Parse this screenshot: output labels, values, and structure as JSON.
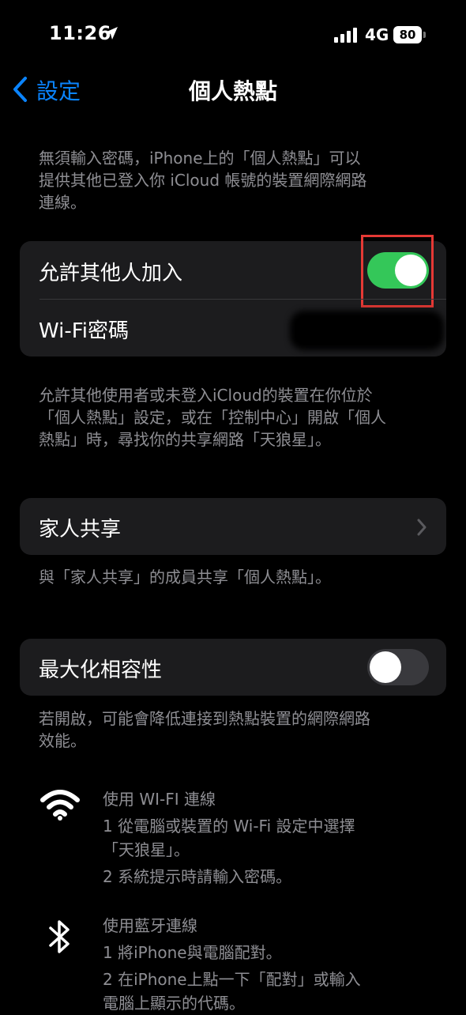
{
  "status_bar": {
    "time": "11:26",
    "network": "4G",
    "battery": "80"
  },
  "nav": {
    "back_label": "設定",
    "title": "個人熱點"
  },
  "intro_text": "無須輸入密碼，iPhone上的「個人熱點」可以提供其他已登入你iCloud帳號的裝置網際網路連線。",
  "intro_lines": [
    "無須輸入密碼，iPhone上的「個人熱點」可以",
    "提供其他已登入你 iCloud 帳號的裝置網際網路",
    "連線。"
  ],
  "allow_others": {
    "label": "允許其他人加入",
    "enabled": true
  },
  "wifi_password": {
    "label": "Wi-Fi密碼"
  },
  "allow_desc_lines": [
    "允許其他使用者或未登入iCloud的裝置在你位於",
    "「個人熱點」設定，或在「控制中心」開啟「個人",
    "熱點」時，尋找你的共享網路「天狼星」。"
  ],
  "family": {
    "label": "家人共享"
  },
  "family_desc": "與「家人共享」的成員共享「個人熱點」。",
  "max_compat": {
    "label": "最大化相容性",
    "enabled": false
  },
  "max_desc_lines": [
    "若開啟，可能會降低連接到熱點裝置的網際網路",
    "效能。"
  ],
  "wifi_help": {
    "title": "使用 WI-FI 連線",
    "step1_lines": [
      "1 從電腦或裝置的 Wi-Fi 設定中選擇",
      "「天狼星」。"
    ],
    "step2": "2 系統提示時請輸入密碼。"
  },
  "bt_help": {
    "title": "使用藍牙連線",
    "step1": "1 將iPhone與電腦配對。",
    "step2_lines": [
      "2 在iPhone上點一下「配對」或輸入",
      "電腦上顯示的代碼。"
    ]
  },
  "colors": {
    "accent": "#0a84ff",
    "toggle_on": "#34c759",
    "highlight": "#e53935"
  }
}
